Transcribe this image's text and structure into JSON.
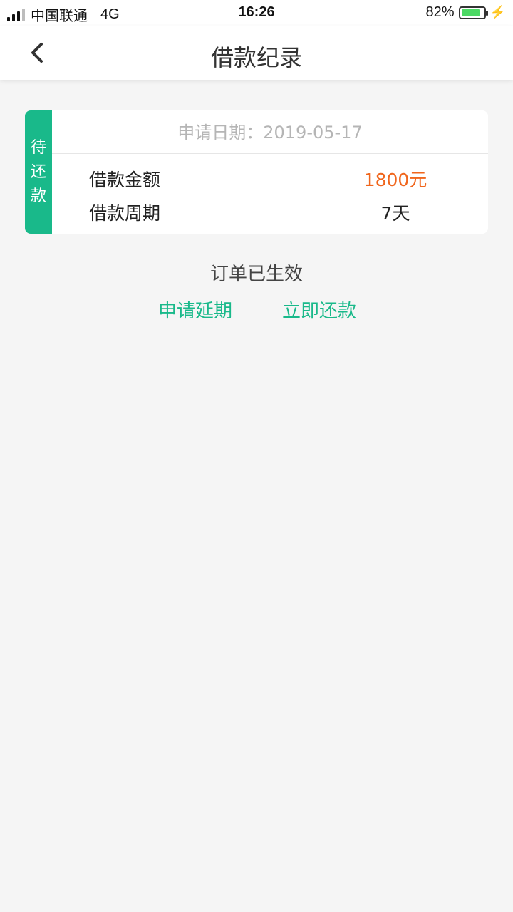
{
  "status_bar": {
    "carrier": "中国联通",
    "network": "4G",
    "time": "16:26",
    "battery_pct": "82%",
    "battery_level": 0.82,
    "signal_bars_active": 3,
    "signal_bars_total": 4,
    "charging_icon": "bolt-icon"
  },
  "nav": {
    "title": "借款纪录",
    "back_icon": "chevron-left-icon"
  },
  "card": {
    "status_tab": [
      "待",
      "还",
      "款"
    ],
    "status_color": "#19b98a",
    "apply_date": "申请日期：2019-05-17",
    "rows": [
      {
        "label": "借款金额",
        "value": "1800元",
        "value_color": "#f0661d"
      },
      {
        "label": "借款周期",
        "value": "7天"
      }
    ]
  },
  "order_status": "订单已生效",
  "actions": {
    "extend": "申请延期",
    "repay": "立即还款",
    "accent_color": "#19b98a"
  }
}
